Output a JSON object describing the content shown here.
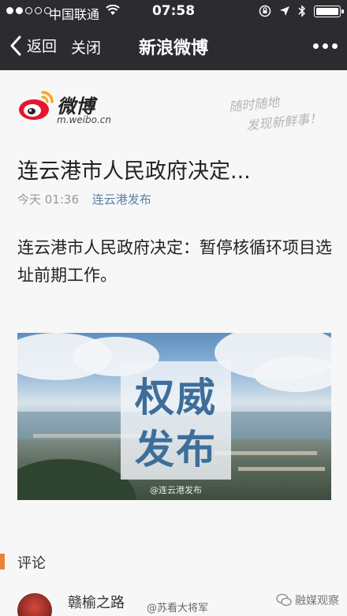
{
  "status_bar": {
    "carrier": "中国联通",
    "time": "07:58"
  },
  "nav": {
    "back_label": "返回",
    "close_label": "关闭",
    "title": "新浪微博"
  },
  "brand": {
    "logo_text": "微博",
    "url": "m.weibo.cn",
    "slogan_line1": "随时随地",
    "slogan_line2": "发现新鲜事！"
  },
  "post": {
    "title": "连云港市人民政府决定...",
    "time": "今天 01:36",
    "author": "连云港发布",
    "body": "连云港市人民政府决定：暂停核循环项目选址前期工作。",
    "image": {
      "badge_line1": "权威",
      "badge_line2": "发布",
      "watermark": "@连云港发布"
    }
  },
  "comments": {
    "label": "评论",
    "items": [
      {
        "name": "赣榆之路"
      }
    ]
  },
  "watermarks": {
    "footer_left": "@苏看大将军",
    "footer_right": "融媒观察"
  },
  "colors": {
    "topbar": "#2c2c30",
    "link": "#5a7fa5",
    "accent": "#e8833a",
    "weibo_red": "#e6162d"
  }
}
